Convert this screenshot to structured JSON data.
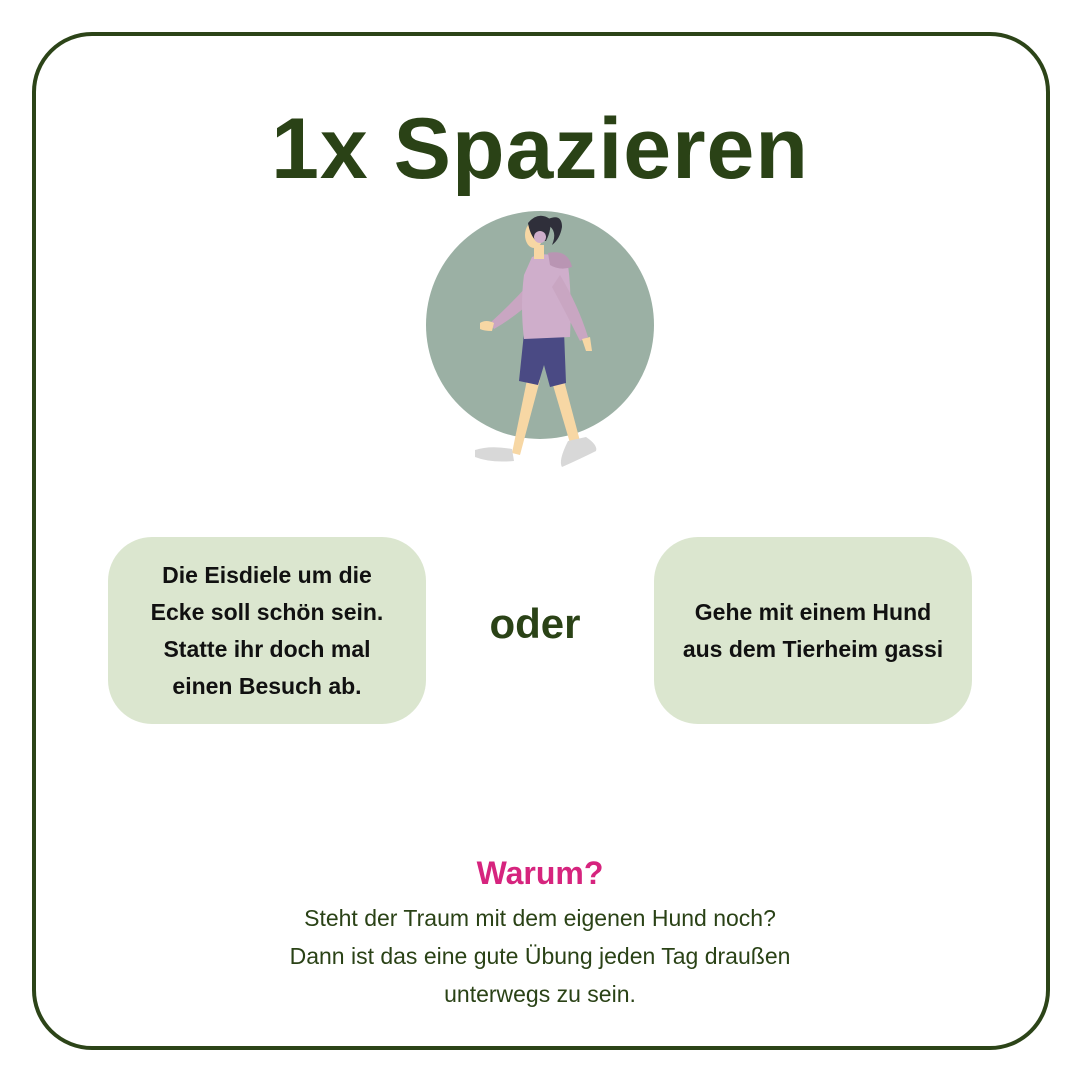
{
  "card": {
    "title": "1x Spazieren",
    "illustration": "walking-woman-with-headphones",
    "options": [
      {
        "text": "Die Eisdiele um die\nEcke soll schön sein.\nStatte ihr doch mal\neinen Besuch ab."
      },
      {
        "text": "Gehe mit einem Hund\naus dem Tierheim gassi"
      }
    ],
    "separator": "oder",
    "why": {
      "heading": "Warum?",
      "text": "Steht der Traum mit dem eigenen Hund noch?\nDann ist das eine gute Übung jeden Tag draußen\nunterwegs zu sein."
    }
  },
  "colors": {
    "border": "#2c4418",
    "title": "#2a4216",
    "box_fill": "#dbe6cf",
    "accent": "#d6247e",
    "circle": "#9bb0a4"
  }
}
